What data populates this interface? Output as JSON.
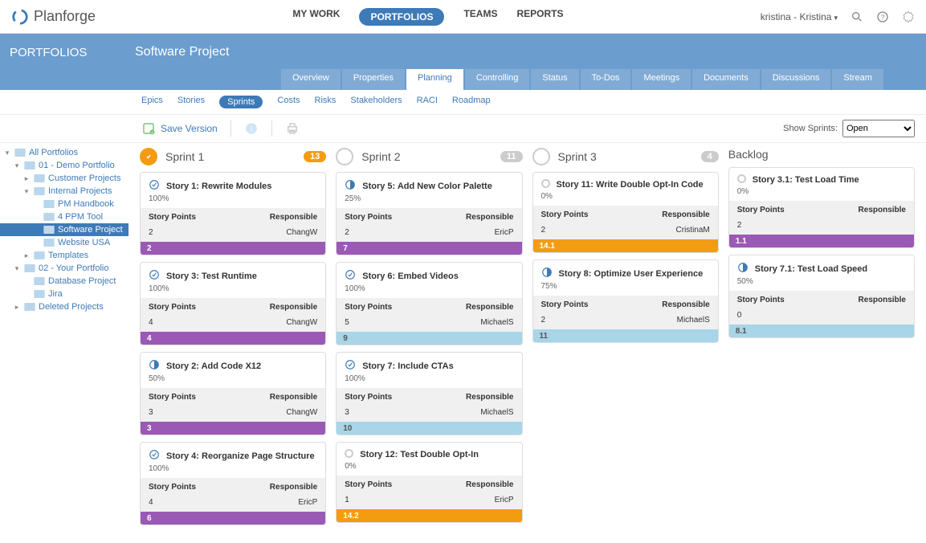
{
  "brand": "Planforge",
  "nav": {
    "mywork": "MY WORK",
    "portfolios": "PORTFOLIOS",
    "teams": "TEAMS",
    "reports": "REPORTS",
    "user": "kristina - Kristina"
  },
  "header": {
    "section": "PORTFOLIOS",
    "title": "Software Project"
  },
  "tabs": [
    "Overview",
    "Properties",
    "Planning",
    "Controlling",
    "Status",
    "To-Dos",
    "Meetings",
    "Documents",
    "Discussions",
    "Stream"
  ],
  "active_tab": "Planning",
  "subtabs": [
    "Epics",
    "Stories",
    "Sprints",
    "Costs",
    "Risks",
    "Stakeholders",
    "RACI",
    "Roadmap"
  ],
  "active_subtab": "Sprints",
  "toolbar": {
    "save_label": "Save Version",
    "show_label": "Show Sprints:",
    "show_value": "Open"
  },
  "sidebar": [
    {
      "label": "All Portfolios",
      "indent": 0,
      "toggle": "-"
    },
    {
      "label": "01 - Demo Portfolio",
      "indent": 1,
      "toggle": "-"
    },
    {
      "label": "Customer Projects",
      "indent": 2,
      "toggle": "+"
    },
    {
      "label": "Internal Projects",
      "indent": 2,
      "toggle": "-"
    },
    {
      "label": "PM Handbook",
      "indent": 3
    },
    {
      "label": "4 PPM Tool",
      "indent": 3
    },
    {
      "label": "Software Project",
      "indent": 3,
      "active": true
    },
    {
      "label": "Website USA",
      "indent": 3
    },
    {
      "label": "Templates",
      "indent": 2,
      "toggle": "+"
    },
    {
      "label": "02 - Your Portfolio",
      "indent": 1,
      "toggle": "-"
    },
    {
      "label": "Database Project",
      "indent": 2
    },
    {
      "label": "Jira",
      "indent": 2
    },
    {
      "label": "Deleted Projects",
      "indent": 1,
      "toggle": "+"
    }
  ],
  "labels": {
    "sp": "Story Points",
    "resp": "Responsible"
  },
  "columns": [
    {
      "name": "Sprint 1",
      "badge": "13",
      "badge_style": "orange",
      "circle": "filled",
      "cards": [
        {
          "title": "Story 1: Rewrite Modules",
          "pct": "100%",
          "sp": "2",
          "resp": "ChangW",
          "bar": "2",
          "bar_color": "purple",
          "status": "done"
        },
        {
          "title": "Story 3: Test Runtime",
          "pct": "100%",
          "sp": "4",
          "resp": "ChangW",
          "bar": "4",
          "bar_color": "purple",
          "status": "done"
        },
        {
          "title": "Story 2: Add Code X12",
          "pct": "50%",
          "sp": "3",
          "resp": "ChangW",
          "bar": "3",
          "bar_color": "purple",
          "status": "half"
        },
        {
          "title": "Story 4: Reorganize Page Structure",
          "pct": "100%",
          "sp": "4",
          "resp": "EricP",
          "bar": "6",
          "bar_color": "purple",
          "status": "done"
        }
      ]
    },
    {
      "name": "Sprint 2",
      "badge": "11",
      "badge_style": "grey",
      "circle": "empty",
      "cards": [
        {
          "title": "Story 5: Add New Color Palette",
          "pct": "25%",
          "sp": "2",
          "resp": "EricP",
          "bar": "7",
          "bar_color": "purple",
          "status": "half"
        },
        {
          "title": "Story 6: Embed Videos",
          "pct": "100%",
          "sp": "5",
          "resp": "MichaelS",
          "bar": "9",
          "bar_color": "lightblue",
          "status": "done"
        },
        {
          "title": "Story 7: Include CTAs",
          "pct": "100%",
          "sp": "3",
          "resp": "MichaelS",
          "bar": "10",
          "bar_color": "lightblue",
          "status": "done"
        },
        {
          "title": "Story 12: Test Double Opt-In",
          "pct": "0%",
          "sp": "1",
          "resp": "EricP",
          "bar": "14.2",
          "bar_color": "orange",
          "status": "empty"
        }
      ]
    },
    {
      "name": "Sprint 3",
      "badge": "4",
      "badge_style": "grey",
      "circle": "empty",
      "cards": [
        {
          "title": "Story 11: Write Double Opt-In Code",
          "pct": "0%",
          "sp": "2",
          "resp": "CristinaM",
          "bar": "14.1",
          "bar_color": "orange",
          "status": "empty"
        },
        {
          "title": "Story 8: Optimize User Experience",
          "pct": "75%",
          "sp": "2",
          "resp": "MichaelS",
          "bar": "11",
          "bar_color": "lightblue",
          "status": "half"
        }
      ]
    },
    {
      "name": "Backlog",
      "badge": "",
      "badge_style": "",
      "circle": "none",
      "cards": [
        {
          "title": "Story 3.1: Test Load Time",
          "pct": "0%",
          "sp": "2",
          "resp": "",
          "bar": "1.1",
          "bar_color": "purple",
          "status": "empty"
        },
        {
          "title": "Story 7.1: Test Load Speed",
          "pct": "50%",
          "sp": "0",
          "resp": "",
          "bar": "8.1",
          "bar_color": "lightblue",
          "status": "half"
        }
      ]
    }
  ]
}
